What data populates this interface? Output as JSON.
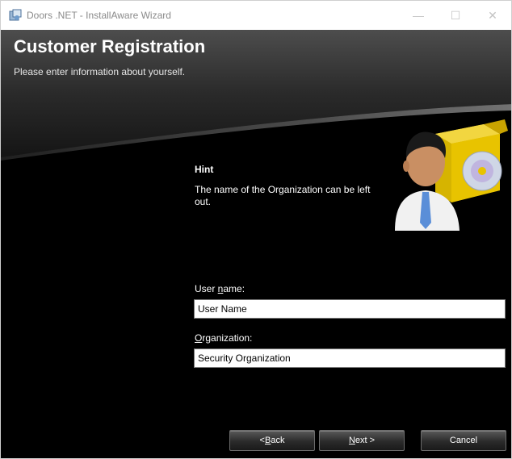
{
  "window": {
    "title": "Doors .NET - InstallAware Wizard",
    "controls": {
      "minimize": "—",
      "maximize": "☐",
      "close": "✕"
    }
  },
  "header": {
    "title": "Customer Registration",
    "subtitle": "Please enter information about yourself."
  },
  "hint": {
    "title": "Hint",
    "text": "The name of the Organization can be left out."
  },
  "form": {
    "username": {
      "label_prefix": "User ",
      "label_accel": "n",
      "label_suffix": "ame:",
      "value": "User Name"
    },
    "organization": {
      "label_prefix": "",
      "label_accel": "O",
      "label_suffix": "rganization:",
      "value": "Security Organization"
    }
  },
  "buttons": {
    "back": {
      "prefix": "< ",
      "accel": "B",
      "suffix": "ack"
    },
    "next": {
      "prefix": "",
      "accel": "N",
      "suffix": "ext >"
    },
    "cancel": {
      "label": "Cancel"
    }
  },
  "colors": {
    "background": "#000000",
    "header_text": "#ffffff",
    "input_bg": "#ffffff"
  }
}
